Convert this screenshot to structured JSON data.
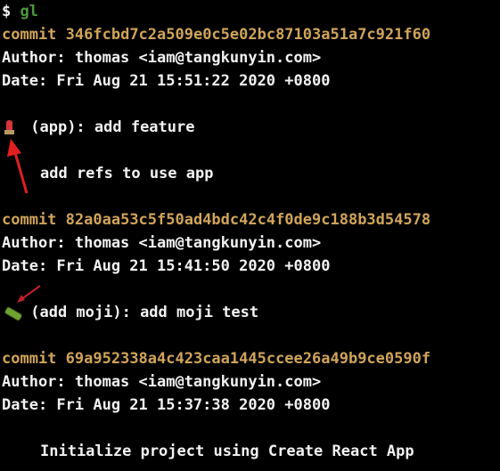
{
  "prompt": {
    "symbol": "$",
    "command": "gl"
  },
  "commits": [
    {
      "commit_label": "commit",
      "hash": "346fcbd7c2a509e0c5e02bc87103a51a7c921f60",
      "author": "Author: thomas <iam@tangkunyin.com>",
      "date": "Date: Fri Aug 21 15:51:22 2020 +0800",
      "emoji": "lipstick-icon",
      "subject": "(app): add feature",
      "body": "add refs to use app"
    },
    {
      "commit_label": "commit",
      "hash": "82a0aa53c5f50ad4bdc42c4f0de9c188b3d54578",
      "author": "Author: thomas <iam@tangkunyin.com>",
      "date": "Date: Fri Aug 21 15:41:50 2020 +0800",
      "emoji": "bamboo-icon",
      "subject": "(add moji): add moji test"
    },
    {
      "commit_label": "commit",
      "hash": "69a952338a4c423caa1445ccee26a49b9ce0590f",
      "author": "Author: thomas <iam@tangkunyin.com>",
      "date": "Date: Fri Aug 21 15:37:38 2020 +0800",
      "body": "Initialize project using Create React App"
    }
  ],
  "colors": {
    "hash": "#d0a45a",
    "command": "#4e9a3a",
    "arrow": "#e02020"
  }
}
